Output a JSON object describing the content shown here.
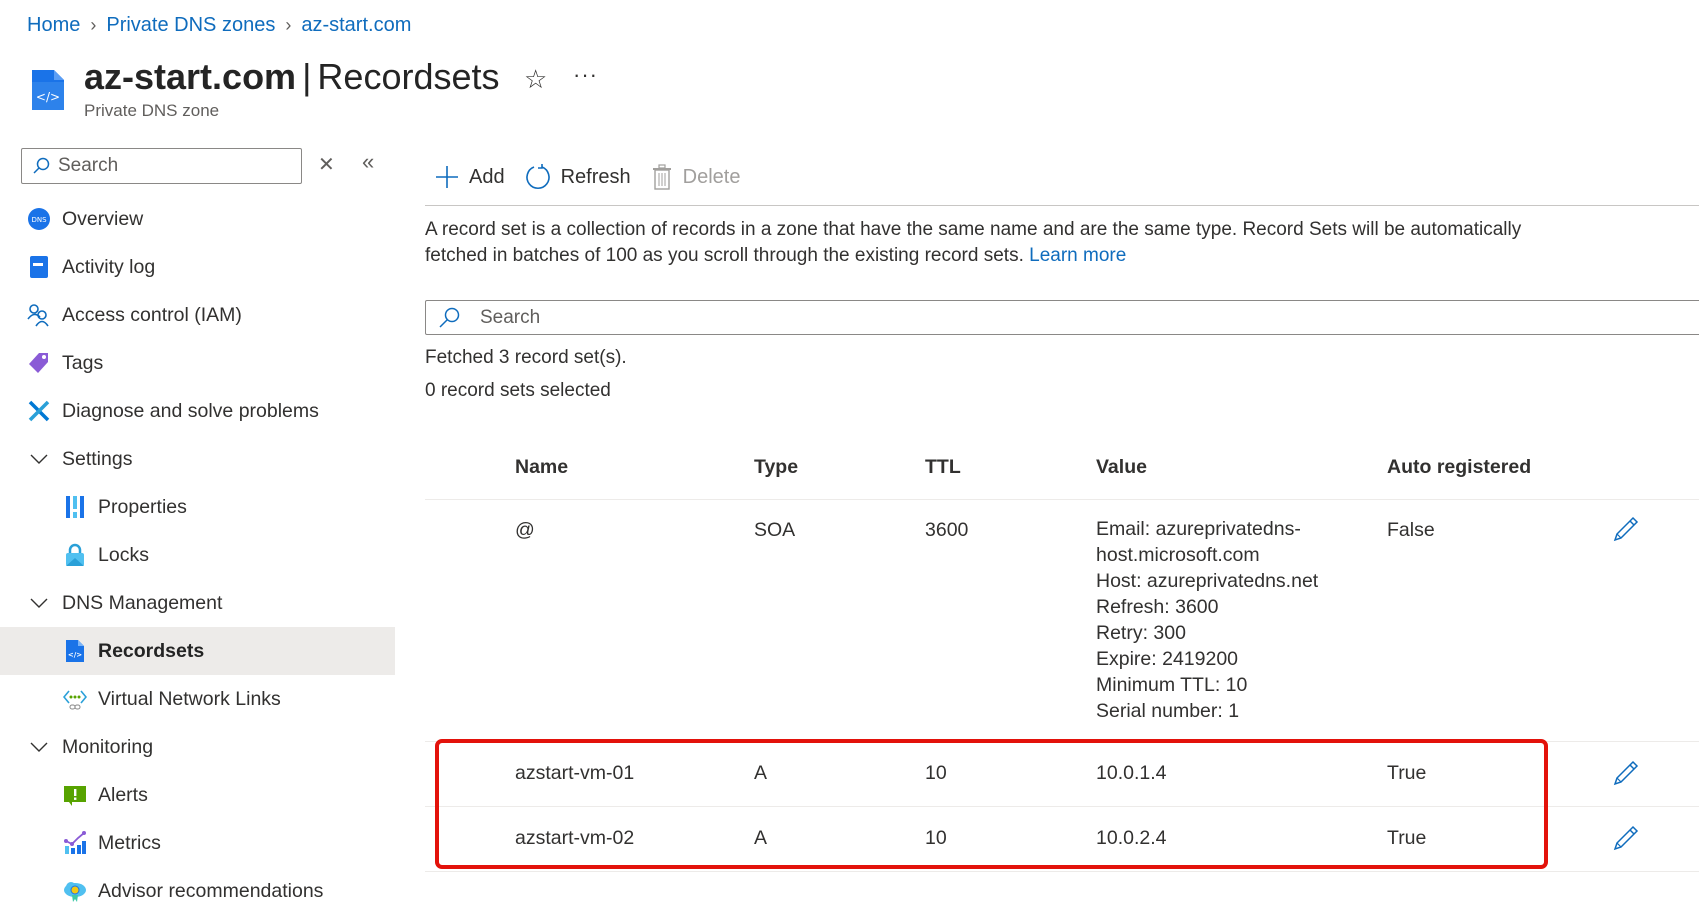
{
  "breadcrumb": [
    {
      "label": "Home"
    },
    {
      "label": "Private DNS zones"
    },
    {
      "label": "az-start.com"
    }
  ],
  "header": {
    "resource_name": "az-start.com",
    "separator": "|",
    "blade_title": "Recordsets",
    "subtitle": "Private DNS zone",
    "favorite_icon": "star-outline-icon",
    "more_icon": "ellipsis-icon",
    "more_label": "···"
  },
  "sidebar": {
    "search_placeholder": "Search",
    "clear_label": "✕",
    "collapse_label": "«",
    "items": [
      {
        "label": "Overview",
        "icon": "dns-icon",
        "level": 0
      },
      {
        "label": "Activity log",
        "icon": "activity-log-icon",
        "level": 0
      },
      {
        "label": "Access control (IAM)",
        "icon": "people-icon",
        "level": 0
      },
      {
        "label": "Tags",
        "icon": "tag-icon",
        "level": 0
      },
      {
        "label": "Diagnose and solve problems",
        "icon": "wrench-icon",
        "level": 0
      },
      {
        "label": "Settings",
        "icon": "chevron-down-icon",
        "level": 0,
        "group": true
      },
      {
        "label": "Properties",
        "icon": "properties-icon",
        "level": 1
      },
      {
        "label": "Locks",
        "icon": "lock-icon",
        "level": 1
      },
      {
        "label": "DNS Management",
        "icon": "chevron-down-icon",
        "level": 0,
        "group": true
      },
      {
        "label": "Recordsets",
        "icon": "recordset-icon",
        "level": 1,
        "selected": true
      },
      {
        "label": "Virtual Network Links",
        "icon": "vnet-link-icon",
        "level": 1
      },
      {
        "label": "Monitoring",
        "icon": "chevron-down-icon",
        "level": 0,
        "group": true
      },
      {
        "label": "Alerts",
        "icon": "alert-icon",
        "level": 1
      },
      {
        "label": "Metrics",
        "icon": "metrics-icon",
        "level": 1
      },
      {
        "label": "Advisor recommendations",
        "icon": "advisor-icon",
        "level": 1
      }
    ]
  },
  "toolbar": {
    "add_label": "Add",
    "refresh_label": "Refresh",
    "delete_label": "Delete"
  },
  "description": {
    "text": "A record set is a collection of records in a zone that have the same name and are the same type. Record Sets will be automatically fetched in batches of 100 as you scroll through the existing record sets.",
    "link_label": "Learn more"
  },
  "search": {
    "placeholder": "Search"
  },
  "status": {
    "fetched": "Fetched 3 record set(s).",
    "selected": "0 record sets selected"
  },
  "table": {
    "columns": [
      "Name",
      "Type",
      "TTL",
      "Value",
      "Auto registered"
    ],
    "rows": [
      {
        "name": "@",
        "type": "SOA",
        "ttl": "3600",
        "value": [
          "Email: azureprivatedns-",
          "host.microsoft.com",
          "Host: azureprivatedns.net",
          "Refresh: 3600",
          "Retry: 300",
          "Expire: 2419200",
          "Minimum TTL: 10",
          "Serial number: 1"
        ],
        "auto_registered": "False"
      },
      {
        "name": "azstart-vm-01",
        "type": "A",
        "ttl": "10",
        "value": [
          "10.0.1.4"
        ],
        "auto_registered": "True"
      },
      {
        "name": "azstart-vm-02",
        "type": "A",
        "ttl": "10",
        "value": [
          "10.0.2.4"
        ],
        "auto_registered": "True"
      }
    ]
  },
  "colors": {
    "accent": "#0f6cbd",
    "highlight_box": "#e3120b",
    "selected_nav_bg": "#edebe9",
    "disabled_text": "#a19f9d"
  }
}
